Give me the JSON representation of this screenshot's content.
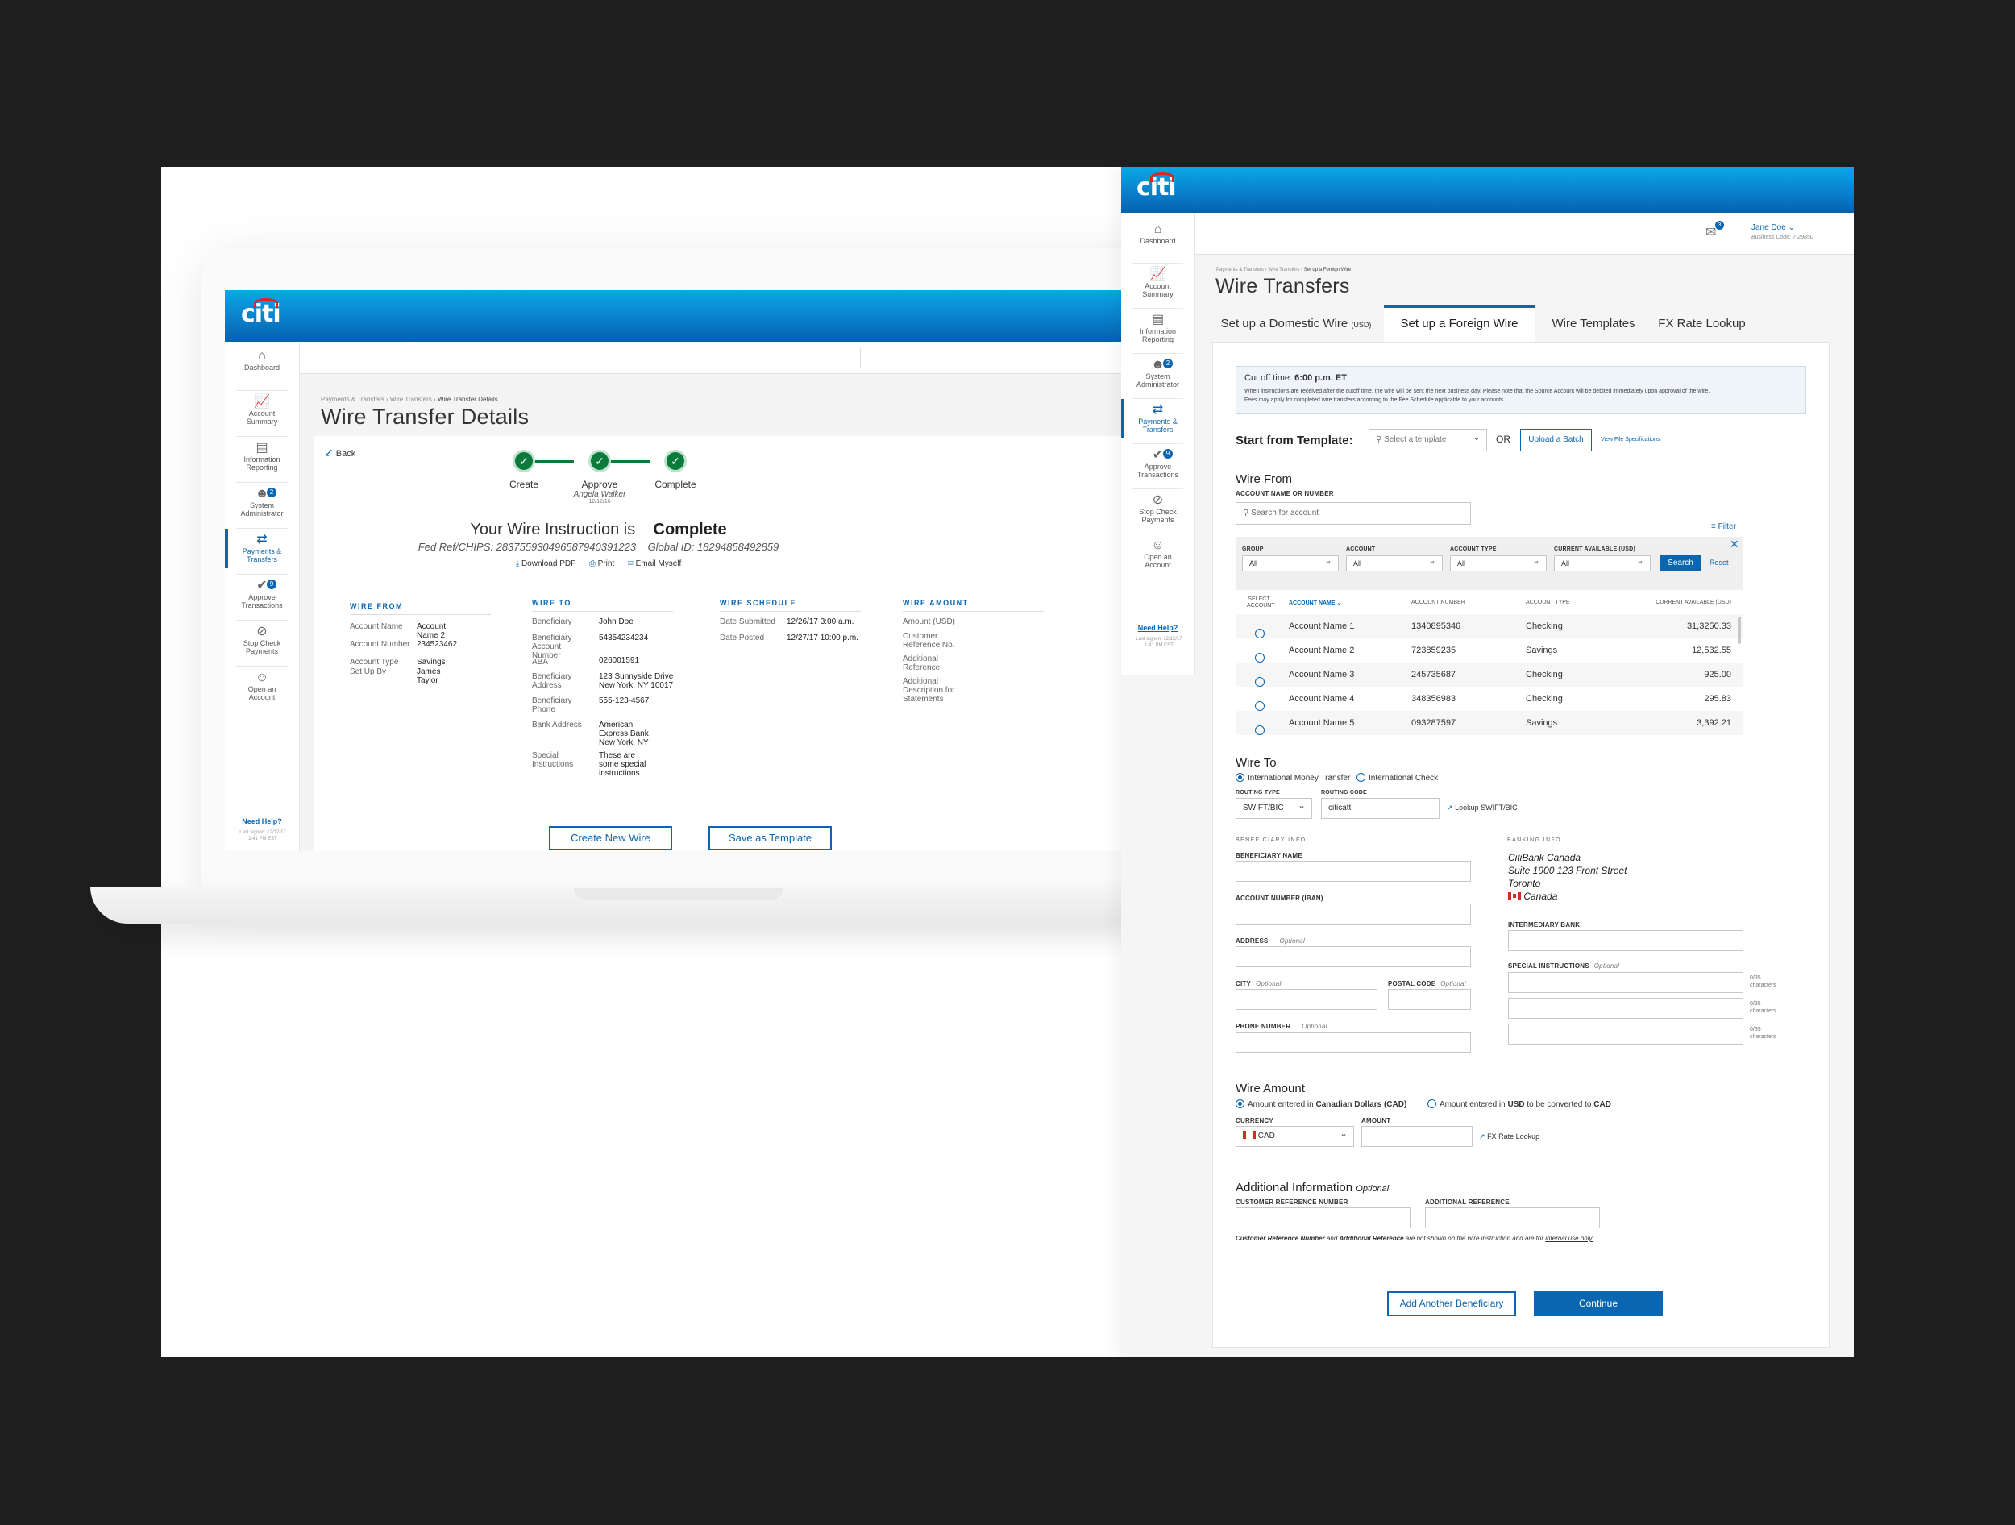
{
  "left": {
    "logo": "citi",
    "nav": [
      {
        "label": "Dashboard",
        "icon": "home-icon"
      },
      {
        "label": "Account Summary",
        "icon": "chart-icon"
      },
      {
        "label": "Information Reporting",
        "icon": "document-icon"
      },
      {
        "label": "System Administrator",
        "icon": "users-icon",
        "badge": "2"
      },
      {
        "label": "Payments & Transfers",
        "icon": "transfer-icon",
        "active": true
      },
      {
        "label": "Approve Transactions",
        "icon": "approve-icon",
        "badge": "9"
      },
      {
        "label": "Stop Check Payments",
        "icon": "stop-icon"
      },
      {
        "label": "Open an Account",
        "icon": "account-icon"
      }
    ],
    "need_help": "Need Help?",
    "last_signon": "Last signon: 12/12/17 1:41 PM EST",
    "breadcrumb": [
      "Payments & Transfers",
      "Wire Transfers",
      "Wire Transfer Details"
    ],
    "title": "Wire Transfer Details",
    "back": "Back",
    "steps": [
      {
        "label": "Create",
        "sub": ""
      },
      {
        "label": "Approve",
        "sub": "Angela Walker",
        "sub2": "12/12/16"
      },
      {
        "label": "Complete",
        "sub": ""
      }
    ],
    "status_prefix": "Your Wire Instruction is",
    "status_value": "Complete",
    "fed_ref": "Fed Ref/CHIPS: 283755930496587940391223",
    "global_id": "Global ID: 18294858492859",
    "actions": [
      "Download PDF",
      "Print",
      "Email Myself"
    ],
    "wire_from": {
      "heading": "WIRE FROM",
      "rows": [
        {
          "k": "Account Name",
          "v": "Account Name 2"
        },
        {
          "k": "Account Number",
          "v": "234523462"
        },
        {
          "k": "Account Type",
          "v": "Savings"
        },
        {
          "k": "Set Up By",
          "v": "James Taylor"
        }
      ]
    },
    "wire_to": {
      "heading": "WIRE TO",
      "rows": [
        {
          "k": "Beneficiary",
          "v": "John Doe"
        },
        {
          "k": "Beneficiary Account Number",
          "v": "54354234234"
        },
        {
          "k": "ABA",
          "v": "026001591"
        },
        {
          "k": "Beneficiary Address",
          "v": "123 Sunnyside Drive New York, NY 10017"
        },
        {
          "k": "Beneficiary Phone",
          "v": "555-123-4567"
        },
        {
          "k": "Bank Address",
          "v": "American Express Bank New York, NY"
        },
        {
          "k": "Special Instructions",
          "v": "These are some special instructions"
        }
      ]
    },
    "wire_schedule": {
      "heading": "WIRE SCHEDULE",
      "rows": [
        {
          "k": "Date Submitted",
          "v": "12/26/17 3:00 a.m."
        },
        {
          "k": "Date Posted",
          "v": "12/27/17 10:00 p.m."
        }
      ]
    },
    "wire_amount": {
      "heading": "WIRE AMOUNT",
      "rows": [
        {
          "k": "Amount (USD)"
        },
        {
          "k": "Customer Reference No."
        },
        {
          "k": "Additional Reference"
        },
        {
          "k": "Additional Description for Statements"
        }
      ]
    },
    "btn_create": "Create New Wire",
    "btn_template": "Save as Template"
  },
  "right": {
    "logo": "citi",
    "nav": [
      {
        "label": "Dashboard",
        "icon": "home-icon"
      },
      {
        "label": "Account Summary",
        "icon": "chart-icon"
      },
      {
        "label": "Information Reporting",
        "icon": "document-icon"
      },
      {
        "label": "System Administrator",
        "icon": "users-icon",
        "badge": "2"
      },
      {
        "label": "Payments & Transfers",
        "icon": "transfer-icon",
        "active": true
      },
      {
        "label": "Approve Transactions",
        "icon": "approve-icon",
        "badge": "9"
      },
      {
        "label": "Stop Check Payments",
        "icon": "stop-icon"
      },
      {
        "label": "Open an Account",
        "icon": "account-icon"
      }
    ],
    "need_help": "Need Help?",
    "last_signon": "Last signon: 12/12/17 1:41 PM EST",
    "mail_badge": "3",
    "user_name": "Jane Doe",
    "business_code": "Business Code: 7-29850",
    "breadcrumb": [
      "Payments & Transfers",
      "Wire Transfers",
      "Set up a Foreign Wire"
    ],
    "title": "Wire Transfers",
    "tabs": [
      {
        "label": "Set up a Domestic Wire",
        "suffix": "(USD)"
      },
      {
        "label": "Set up a Foreign Wire",
        "active": true
      },
      {
        "label": "Wire Templates"
      },
      {
        "label": "FX Rate Lookup"
      }
    ],
    "cutoff_label": "Cut off time:",
    "cutoff_value": "6:00 p.m. ET",
    "cutoff_note1": "When instructions are received after the cutoff time, the wire will be sent the next business day. Please note that the Source Account will be debited immediately upon approval of the wire.",
    "cutoff_note2": "Fees may apply for completed wire transfers according to the Fee Schedule applicable to your accounts.",
    "template_label": "Start from Template:",
    "template_placeholder": "Select a template",
    "or": "OR",
    "upload_batch": "Upload a Batch",
    "view_spec": "View File Specifications",
    "wire_from_h": "Wire From",
    "account_label": "ACCOUNT NAME OR NUMBER",
    "account_placeholder": "Search for account",
    "filter": "Filter",
    "filters": [
      {
        "label": "GROUP",
        "value": "All"
      },
      {
        "label": "ACCOUNT",
        "value": "All"
      },
      {
        "label": "ACCOUNT TYPE",
        "value": "All"
      },
      {
        "label": "CURRENT AVAILABLE (USD)",
        "value": "All"
      }
    ],
    "search_btn": "Search",
    "reset": "Reset",
    "cols": [
      "SELECT ACCOUNT",
      "ACCOUNT NAME",
      "ACCOUNT NUMBER",
      "ACCOUNT TYPE",
      "CURRENT AVAILABLE (USD)"
    ],
    "rows": [
      {
        "name": "Account Name 1",
        "number": "1340895346",
        "type": "Checking",
        "avail": "31,3250.33"
      },
      {
        "name": "Account Name 2",
        "number": "723859235",
        "type": "Savings",
        "avail": "12,532.55"
      },
      {
        "name": "Account Name 3",
        "number": "245735687",
        "type": "Checking",
        "avail": "925.00"
      },
      {
        "name": "Account Name 4",
        "number": "348356983",
        "type": "Checking",
        "avail": "295.83"
      },
      {
        "name": "Account Name 5",
        "number": "093287597",
        "type": "Savings",
        "avail": "3,392.21"
      }
    ],
    "wire_to_h": "Wire To",
    "imt": "International Money Transfer",
    "icheck": "International Check",
    "routing_type_label": "ROUTING TYPE",
    "routing_type_value": "SWIFT/BIC",
    "routing_code_label": "ROUTING CODE",
    "routing_code_value": "citicatt",
    "lookup_swift": "Lookup SWIFT/BIC",
    "beneficiary_info": "BENEFICIARY INFO",
    "banking_info": "BANKING INFO",
    "ben_name": "BENEFICIARY NAME",
    "acct_iban": "ACCOUNT NUMBER (IBAN)",
    "address": "ADDRESS",
    "city": "CITY",
    "postal": "POSTAL CODE",
    "phone": "PHONE NUMBER",
    "optional": "Optional",
    "bank_name": "CitiBank Canada",
    "bank_addr1": "Suite 1900 123 Front Street",
    "bank_city": "Toronto",
    "bank_country": "Canada",
    "intermediary": "INTERMEDIARY BANK",
    "special": "SPECIAL INSTRUCTIONS",
    "char_count": "0/35 characters",
    "wire_amount_h": "Wire Amount",
    "amt_opt1_a": "Amount entered in",
    "amt_opt1_b": "Canadian Dollars (CAD)",
    "amt_opt2_a": "Amount entered in",
    "amt_opt2_b": "USD",
    "amt_opt2_c": "to be converted to",
    "amt_opt2_d": "CAD",
    "currency_label": "CURRENCY",
    "currency_value": "CAD",
    "amount_label": "AMOUNT",
    "fx_lookup": "FX Rate Lookup",
    "addl_h": "Additional Information",
    "addl_opt": "Optional",
    "cust_ref": "CUSTOMER REFERENCE NUMBER",
    "addl_ref": "ADDITIONAL REFERENCE",
    "note_a": "Customer Reference Number",
    "note_b": "and",
    "note_c": "Additional Reference",
    "note_d": "are not shown on the wire instruction and are for",
    "note_e": "internal use only.",
    "add_beneficiary": "Add Another Beneficiary",
    "continue": "Continue"
  },
  "colors": {
    "brand": "#0a66b0",
    "success": "#0b7a3b",
    "logo_arc": "#e2231a"
  }
}
